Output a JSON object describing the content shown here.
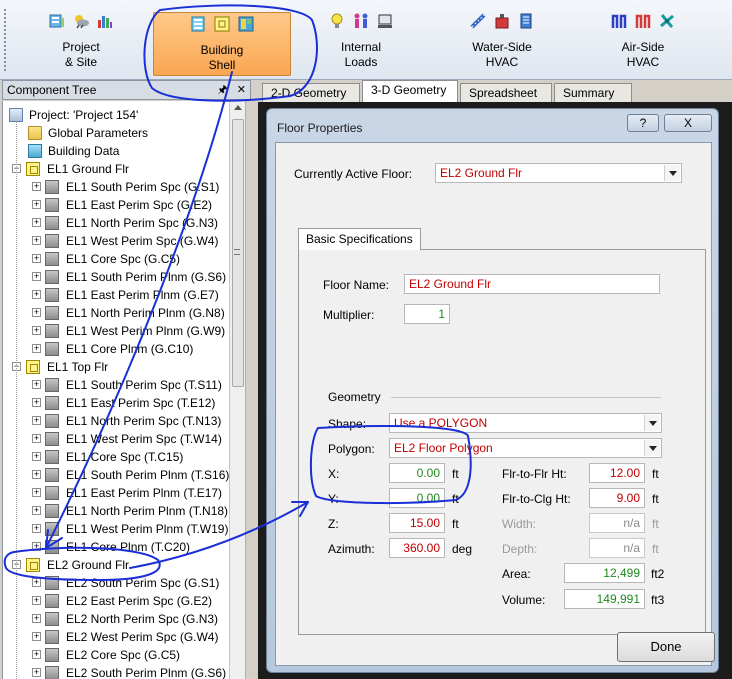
{
  "ribbon": {
    "groups": [
      {
        "id": "project",
        "label_line1": "Project",
        "label_line2": "& Site"
      },
      {
        "id": "building",
        "label_line1": "Building",
        "label_line2": "Shell"
      },
      {
        "id": "internal",
        "label_line1": "Internal",
        "label_line2": "Loads"
      },
      {
        "id": "water",
        "label_line1": "Water-Side",
        "label_line2": "HVAC"
      },
      {
        "id": "air",
        "label_line1": "Air-Side",
        "label_line2": "HVAC"
      }
    ]
  },
  "tree": {
    "title": "Component Tree",
    "pin_icon": "pin-icon",
    "close_icon": "close-icon",
    "nodes": [
      {
        "label": "Project:  'Project 154'",
        "icon": "project-icon"
      },
      {
        "label": "Global Parameters",
        "icon": "folder-icon"
      },
      {
        "label": "Building Data",
        "icon": "building-data-icon"
      },
      {
        "label": "EL1 Ground Flr",
        "icon": "floor-icon"
      },
      {
        "label": "EL1 South Perim Spc (G.S1)",
        "icon": "space-icon"
      },
      {
        "label": "EL1 East Perim Spc (G.E2)",
        "icon": "space-icon"
      },
      {
        "label": "EL1 North Perim Spc (G.N3)",
        "icon": "space-icon"
      },
      {
        "label": "EL1 West Perim Spc (G.W4)",
        "icon": "space-icon"
      },
      {
        "label": "EL1 Core Spc (G.C5)",
        "icon": "space-icon"
      },
      {
        "label": "EL1 South Perim Plnm (G.S6)",
        "icon": "space-icon"
      },
      {
        "label": "EL1 East Perim Plnm (G.E7)",
        "icon": "space-icon"
      },
      {
        "label": "EL1 North Perim Plnm (G.N8)",
        "icon": "space-icon"
      },
      {
        "label": "EL1 West Perim Plnm (G.W9)",
        "icon": "space-icon"
      },
      {
        "label": "EL1 Core Plnm (G.C10)",
        "icon": "space-icon"
      },
      {
        "label": "EL1 Top Flr",
        "icon": "floor-icon"
      },
      {
        "label": "EL1 South Perim Spc (T.S11)",
        "icon": "space-icon"
      },
      {
        "label": "EL1 East Perim Spc (T.E12)",
        "icon": "space-icon"
      },
      {
        "label": "EL1 North Perim Spc (T.N13)",
        "icon": "space-icon"
      },
      {
        "label": "EL1 West Perim Spc (T.W14)",
        "icon": "space-icon"
      },
      {
        "label": "EL1 Core Spc (T.C15)",
        "icon": "space-icon"
      },
      {
        "label": "EL1 South Perim Plnm (T.S16)",
        "icon": "space-icon"
      },
      {
        "label": "EL1 East Perim Plnm (T.E17)",
        "icon": "space-icon"
      },
      {
        "label": "EL1 North Perim Plnm (T.N18)",
        "icon": "space-icon"
      },
      {
        "label": "EL1 West Perim Plnm (T.W19)",
        "icon": "space-icon"
      },
      {
        "label": "EL1 Core Plnm (T.C20)",
        "icon": "space-icon"
      },
      {
        "label": "EL2 Ground Flr",
        "icon": "floor-icon"
      },
      {
        "label": "EL2 South Perim Spc (G.S1)",
        "icon": "space-icon"
      },
      {
        "label": "EL2 East Perim Spc (G.E2)",
        "icon": "space-icon"
      },
      {
        "label": "EL2 North Perim Spc (G.N3)",
        "icon": "space-icon"
      },
      {
        "label": "EL2 West Perim Spc (G.W4)",
        "icon": "space-icon"
      },
      {
        "label": "EL2 Core Spc (G.C5)",
        "icon": "space-icon"
      },
      {
        "label": "EL2 South Perim Plnm (G.S6)",
        "icon": "space-icon"
      }
    ]
  },
  "tabs": [
    {
      "label": "2-D Geometry"
    },
    {
      "label": "3-D Geometry"
    },
    {
      "label": "Spreadsheet"
    },
    {
      "label": "Summary"
    }
  ],
  "dialog": {
    "title": "Floor Properties",
    "help_label": "?",
    "close_label": "X",
    "active_floor_label": "Currently Active Floor:",
    "active_floor_value": "EL2 Ground Flr",
    "basic_tab_label": "Basic Specifications",
    "floor_name_label": "Floor Name:",
    "floor_name_value": "EL2 Ground Flr",
    "multiplier_label": "Multiplier:",
    "multiplier_value": "1",
    "geometry_label": "Geometry",
    "shape_label": "Shape:",
    "shape_value": "Use a POLYGON",
    "polygon_label": "Polygon:",
    "polygon_value": "EL2 Floor Polygon",
    "x_label": "X:",
    "x_value": "0.00",
    "x_unit": "ft",
    "y_label": "Y:",
    "y_value": "0.00",
    "y_unit": "ft",
    "z_label": "Z:",
    "z_value": "15.00",
    "z_unit": "ft",
    "azimuth_label": "Azimuth:",
    "azimuth_value": "360.00",
    "azimuth_unit": "deg",
    "flr_to_flr_label": "Flr-to-Flr Ht:",
    "flr_to_flr_value": "12.00",
    "flr_to_flr_unit": "ft",
    "flr_to_clg_label": "Flr-to-Clg Ht:",
    "flr_to_clg_value": "9.00",
    "flr_to_clg_unit": "ft",
    "width_label": "Width:",
    "width_value": "n/a",
    "width_unit": "ft",
    "depth_label": "Depth:",
    "depth_value": "n/a",
    "depth_unit": "ft",
    "area_label": "Area:",
    "area_value": "12,499",
    "area_unit": "ft2",
    "volume_label": "Volume:",
    "volume_value": "149,991",
    "volume_unit": "ft3",
    "done_label": "Done"
  },
  "colors": {
    "accent_active_group": "#f9a652",
    "annotation_ink": "#1a2fd6",
    "value_red": "#c00000",
    "value_green": "#1d8a1d"
  }
}
